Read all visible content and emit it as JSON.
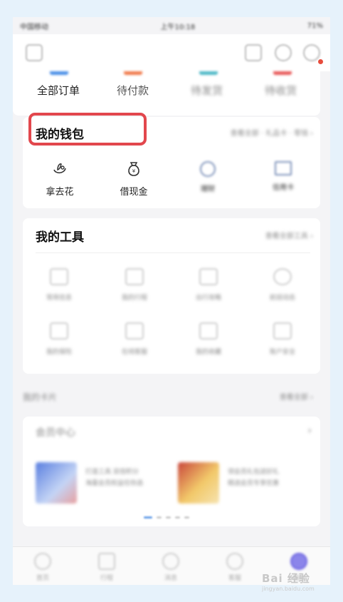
{
  "status_bar": {
    "carrier": "中国移动",
    "time": "上午10:18",
    "battery": "71%"
  },
  "orders": {
    "items": [
      {
        "label": "全部订单",
        "clear": true,
        "color": "#4a8fe7"
      },
      {
        "label": "待付款",
        "clear": true,
        "color": "#f07a4a"
      },
      {
        "label": "待发货",
        "clear": false,
        "color": "#4fb9c7"
      },
      {
        "label": "待收货",
        "clear": false,
        "color": "#e85a5a"
      }
    ]
  },
  "wallet": {
    "title": "我的钱包",
    "more": "查看全部 · 礼品卡 · 零钱 ›",
    "items": [
      {
        "label": "拿去花",
        "icon": "flower-icon",
        "clear": true
      },
      {
        "label": "借现金",
        "icon": "money-bag-icon",
        "clear": true
      },
      {
        "label": "理财",
        "icon": "coin-icon",
        "clear": false
      },
      {
        "label": "信用卡",
        "icon": "card-icon",
        "clear": false
      }
    ]
  },
  "tools": {
    "title": "我的工具",
    "more": "查看全部工具 ›",
    "items": [
      "常用信息",
      "我的行程",
      "出行攻略",
      "航班动态",
      "我的保险",
      "在线客服",
      "我的收藏",
      "账户安全"
    ]
  },
  "cards_section": {
    "label": "我的卡片",
    "more": "查看全部 ›"
  },
  "member": {
    "title": "会员中心",
    "arrow": "›",
    "promos": [
      "打造工具 双倍积分",
      "海量会员权益任你选",
      "领会员礼包送好礼",
      "精选会员专享优惠"
    ]
  },
  "tabbar": {
    "items": [
      "首页",
      "行程",
      "消息",
      "客服",
      "我的"
    ]
  },
  "watermark": {
    "brand": "Bai 经验",
    "url": "jingyan.baidu.com"
  }
}
